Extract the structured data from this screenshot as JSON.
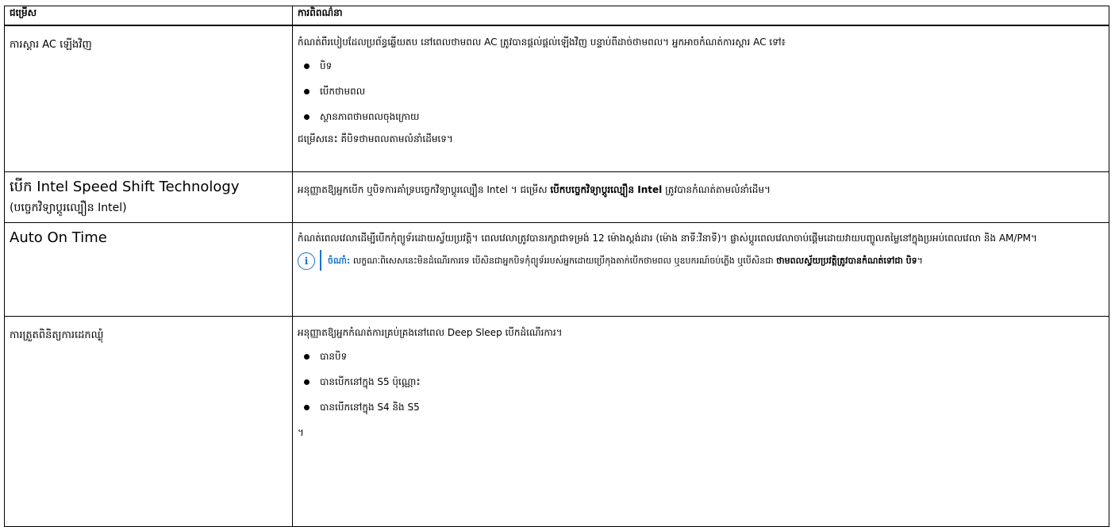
{
  "header": {
    "col_option": "ជម្រើស",
    "col_description": "ការពិពណ៌នា"
  },
  "rows": [
    {
      "label": "ការស្ដារ AC ឡើងវិញ",
      "description": "កំណត់ពីរបៀបដែលប្រព័ន្ធឆ្លើយតប នៅពេលថាមពល AC ត្រូវបានផ្ដល់ផ្ដល់ឡើងវិញ បន្ទាប់ពីដាច់ថាមពល។ អ្នកអាចកំណត់ការស្ដារ AC ទៅ៖",
      "options": [
        "បិទ",
        "បើកថាមពល",
        "ស្ថានភាពថាមពលចុងក្រោយ"
      ],
      "footer": "ជម្រើសនេះ គឺបិទថាមពលតាមលំនាំដើមទេ។"
    },
    {
      "label_line1": "បើក Intel Speed Shift Technology",
      "label_line2": "(បច្ចេកវិទ្យាប្ដូរល្បឿន Intel)",
      "description_a": "អនុញ្ញាតឱ្យអ្នកបើក ឬបិទការគាំទ្របច្ចេកវិទ្យាប្ដូរល្បឿន Intel ។ ជម្រើស",
      "description_bold": "បើកបច្ចេកវិទ្យាប្ដូរល្បឿន Intel",
      "description_b": "ត្រូវបានកំណត់តាមលំនាំដើម។"
    },
    {
      "label": "Auto On Time",
      "description": "កំណត់ពេលវេលាដើម្បីបើកកុំព្យូទ័រដោយស្វ័យប្រវត្តិ។ ពេលវេលាត្រូវបានរក្សាជាទម្រង់ 12 ម៉ោងស្ដង់ដារ (ម៉ោង នាទី:វិនាទី)។ ផ្លាស់ប្ដូរពេលវេលាចាប់ផ្ដើមដោយវាយបញ្ចូលតម្លៃនៅក្នុងប្រអប់ពេលវេលា និង AM/PM។",
      "note_label": "ចំណាំ:",
      "note_text": "លក្ខណៈពិសេសនេះមិនដំណើរការទេ បើសិនជាអ្នកបិទកុំព្យូទ័ររបស់អ្នកដោយប្រើកុងតាក់បើកថាមពល ឬឧបករណ៍ចប់ភ្លើង ឬបើសិនជា",
      "note_bold": "ថាមពលស្វ័យប្រវត្តិត្រូវបានកំណត់ទៅជា បិទ",
      "note_end": "។"
    },
    {
      "label": "ការត្រួតពិនិត្យការដេកឈ្ងុំ",
      "description": "អនុញ្ញាតឱ្យអ្នកកំណត់ការគ្រប់គ្រងនៅពេល Deep Sleep បើកដំណើរការ។",
      "options": [
        "បានបិទ",
        "បានបើកនៅក្នុង S5 ប៉ុណ្ណោះ",
        "បានបើកនៅក្នុង S4 និង S5"
      ],
      "footer": "។"
    }
  ],
  "colors": {
    "note_accent": "#1a73c7",
    "border": "#000000"
  },
  "icons": {
    "note_icon": "info-icon"
  }
}
